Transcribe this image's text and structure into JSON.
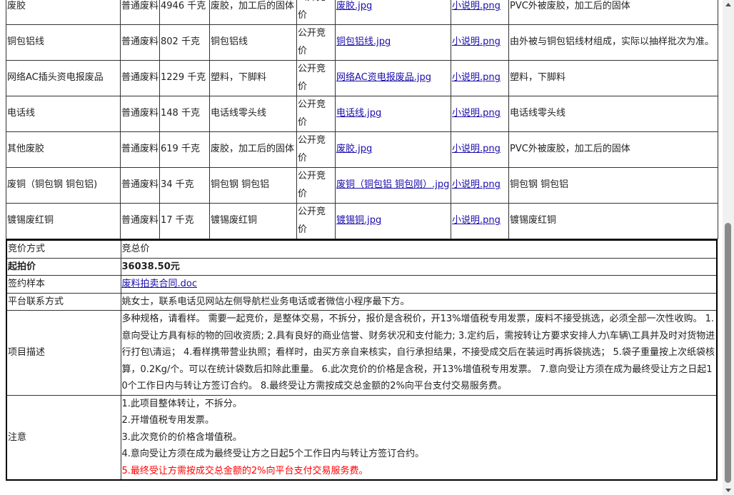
{
  "items": [
    {
      "name": "废胶",
      "type": "普通废料",
      "qty": "4946 千克",
      "desc": "废胶，加工后的固体",
      "method": "公开竞价",
      "photo": "废胶.jpg",
      "doc": "小说明.png",
      "remark": "PVC外被废胶，加工后的固体"
    },
    {
      "name": "铜包铝线",
      "type": "普通废料",
      "qty": "802 千克",
      "desc": "铜包铝线",
      "method": "公开竞价",
      "photo": "铜包铝线.jpg",
      "doc": "小说明.png",
      "remark": "由外被与铜包铝线材组成，实际以抽样批次为准。"
    },
    {
      "name": "网络AC插头资电报废品",
      "type": "普通废料",
      "qty": "1229 千克",
      "desc": "塑料，下脚料",
      "method": "公开竞价",
      "photo": "网络AC资电报废品.jpg",
      "doc": "小说明.png",
      "remark": "塑料，下脚料"
    },
    {
      "name": "电话线",
      "type": "普通废料",
      "qty": "148 千克",
      "desc": "电话线零头线",
      "method": "公开竞价",
      "photo": "电话线.jpg",
      "doc": "小说明.png",
      "remark": "电话线零头线"
    },
    {
      "name": "其他废胶",
      "type": "普通废料",
      "qty": "619 千克",
      "desc": "废胶，加工后的固体",
      "method": "公开竞价",
      "photo": "废胶.jpg",
      "doc": "小说明.png",
      "remark": "PVC外被废胶，加工后的固体"
    },
    {
      "name": "废铜（铜包钢 铜包铝)",
      "type": "普通废料",
      "qty": "34 千克",
      "desc": "铜包钢 铜包铝",
      "method": "公开竞价",
      "photo": "废铜（铜包铝 铜包刚）.jpg",
      "doc": "小说明.png",
      "remark": "铜包钢 铜包铝"
    },
    {
      "name": "镀锡废红铜",
      "type": "普通废料",
      "qty": "17 千克",
      "desc": "镀锡废红铜",
      "method": "公开竞价",
      "photo": "镀锡铜.jpg",
      "doc": "小说明.png",
      "remark": "镀锡废红铜"
    }
  ],
  "details": {
    "bid_mode_label": "竞价方式",
    "bid_mode_value": "竞总价",
    "start_price_label": "起拍价",
    "start_price_value": "36038.50元",
    "contract_label": "签约样本",
    "contract_link": "废料拍卖合同.doc",
    "contact_label": "平台联系方式",
    "contact_value": "姚女士，联系电话见网站左侧导航栏业务电话或者微信小程序最下方。",
    "desc_label": "项目描述",
    "desc_value": "多种规格，请看样。 需要一起竞价，是整体交易，不拆分，报价是含税价，开13%增值税专用发票，废料不接受挑选，必须全部一次性收购。 1.意向受让方具有标的物的回收资质; 2.具有良好的商业信誉、财务状况和支付能力; 3.定约后，需按转让方要求安排人力\\车辆\\工具并及时对货物进行打包\\清运； 4.看样携带营业执照；看样时，由买方亲自来核实，自行承担结果，不接受成交后在装运时再拆袋挑选； 5.袋子重量按上次纸袋核算，0.2Kg/个。可以在统计袋数后扣除此重量。 6.此次竞价的价格是含税，开13%增值税专用发票。 7.意向受让方须在成为最终受让方之日起10个工作日内与转让方签订合约。 8.最终受让方需按成交总金额的2%向平台支付交易服务费。",
    "note_label": "注意",
    "notes": [
      "1.此项目整体转让，不拆分。",
      "2.开增值税专用发票。",
      "3.此次竞价的价格含增值税。",
      "4.意向受让方须在成为最终受让方之日起5个工作日内与转让方签订合约。"
    ],
    "note_red": "5.最终受让方需按成交总金额的2%向平台支付交易服务费。",
    "note_red_color": "#ff0000"
  },
  "icons": {
    "scroll_up": "chevron-up-icon",
    "scroll_down": "chevron-down-icon"
  }
}
